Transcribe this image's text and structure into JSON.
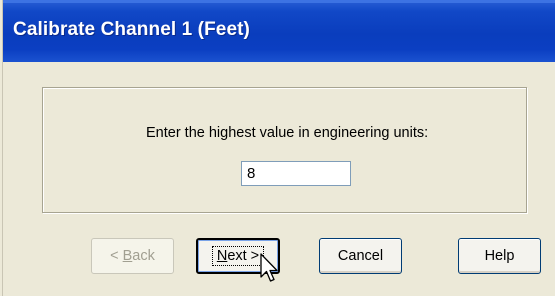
{
  "window": {
    "title": "Calibrate Channel 1 (Feet)"
  },
  "form": {
    "prompt": "Enter the highest value in engineering units:",
    "value": "8"
  },
  "buttons": {
    "back": {
      "prefix": "< ",
      "accel": "B",
      "rest": "ack",
      "enabled": false
    },
    "next": {
      "accel": "N",
      "rest": "ext >",
      "enabled": true,
      "default": true
    },
    "cancel": {
      "label": "Cancel",
      "enabled": true
    },
    "help": {
      "label": "Help",
      "enabled": true
    }
  },
  "icons": {
    "cursor": "mouse-pointer-arrow"
  }
}
